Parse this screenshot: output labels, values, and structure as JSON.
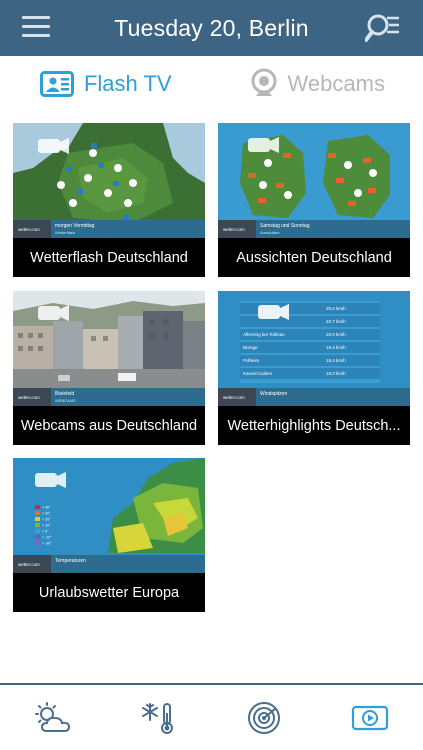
{
  "header": {
    "title": "Tuesday 20, Berlin"
  },
  "tabs": [
    {
      "label": "Flash TV",
      "active": true
    },
    {
      "label": "Webcams",
      "active": false
    }
  ],
  "videos": [
    {
      "caption": "Wetterflash Deutschland",
      "overlay_title": "morgen Vormittag",
      "overlay_sub": "Wetterflash"
    },
    {
      "caption": "Aussichten Deutschland",
      "overlay_title": "Samstag und Sonntag",
      "overlay_sub": "Aussichten"
    },
    {
      "caption": "Webcams aus Deutschland",
      "overlay_title": "Bielefeld",
      "overlay_sub": "WEBCAMS"
    },
    {
      "caption": "Wetterhighlights Deutsch...",
      "overlay_title": "Windspitzen",
      "overlay_sub": ""
    },
    {
      "caption": "Urlaubswetter Europa",
      "overlay_title": "Temperaturen",
      "overlay_sub": ""
    }
  ],
  "wind_table": [
    {
      "place": "",
      "value": "25.6 km/h"
    },
    {
      "place": "",
      "value": "22.7 km/h"
    },
    {
      "place": "Affersing bei Tollmau",
      "value": "20.9 km/h"
    },
    {
      "place": "Brenge",
      "value": "19.4 km/h"
    },
    {
      "place": "Pulheim",
      "value": "19.4 km/h"
    },
    {
      "place": "Kassel-Calden",
      "value": "18.0 km/h"
    }
  ],
  "legend": [
    "> 40°",
    "> 30°",
    "> 20°",
    "> 10°",
    "> 0°",
    "> -10°",
    "> -20°"
  ],
  "brand": "wetter.com",
  "colors": {
    "header": "#3d6483",
    "accent": "#2f9fd8",
    "inactive": "#b7b7b7"
  },
  "bottom_nav": [
    "sun-cloud-icon",
    "snow-thermometer-icon",
    "radar-icon",
    "video-play-icon"
  ]
}
